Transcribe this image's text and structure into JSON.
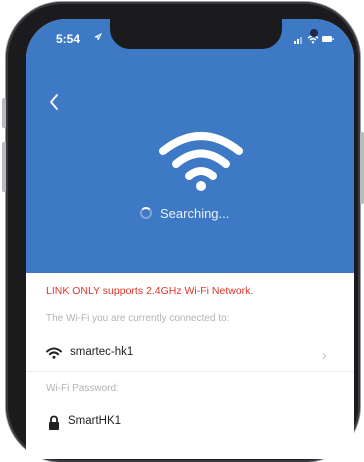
{
  "status_bar": {
    "time": "5:54"
  },
  "header": {
    "back_icon": "chevron-left-icon",
    "wifi_icon": "wifi-icon",
    "searching_text": "Searching..."
  },
  "colors": {
    "header_bg": "#3d79c4",
    "warning": "#e0352b"
  },
  "content": {
    "warning_text": "LINK ONLY supports 2.4GHz Wi-Fi Network.",
    "connected_label": "The Wi-Fi you are currently connected to:",
    "network_name": "smartec-hk1",
    "password_label": "Wi-Fi Password:",
    "password_value": "SmartHK1"
  }
}
